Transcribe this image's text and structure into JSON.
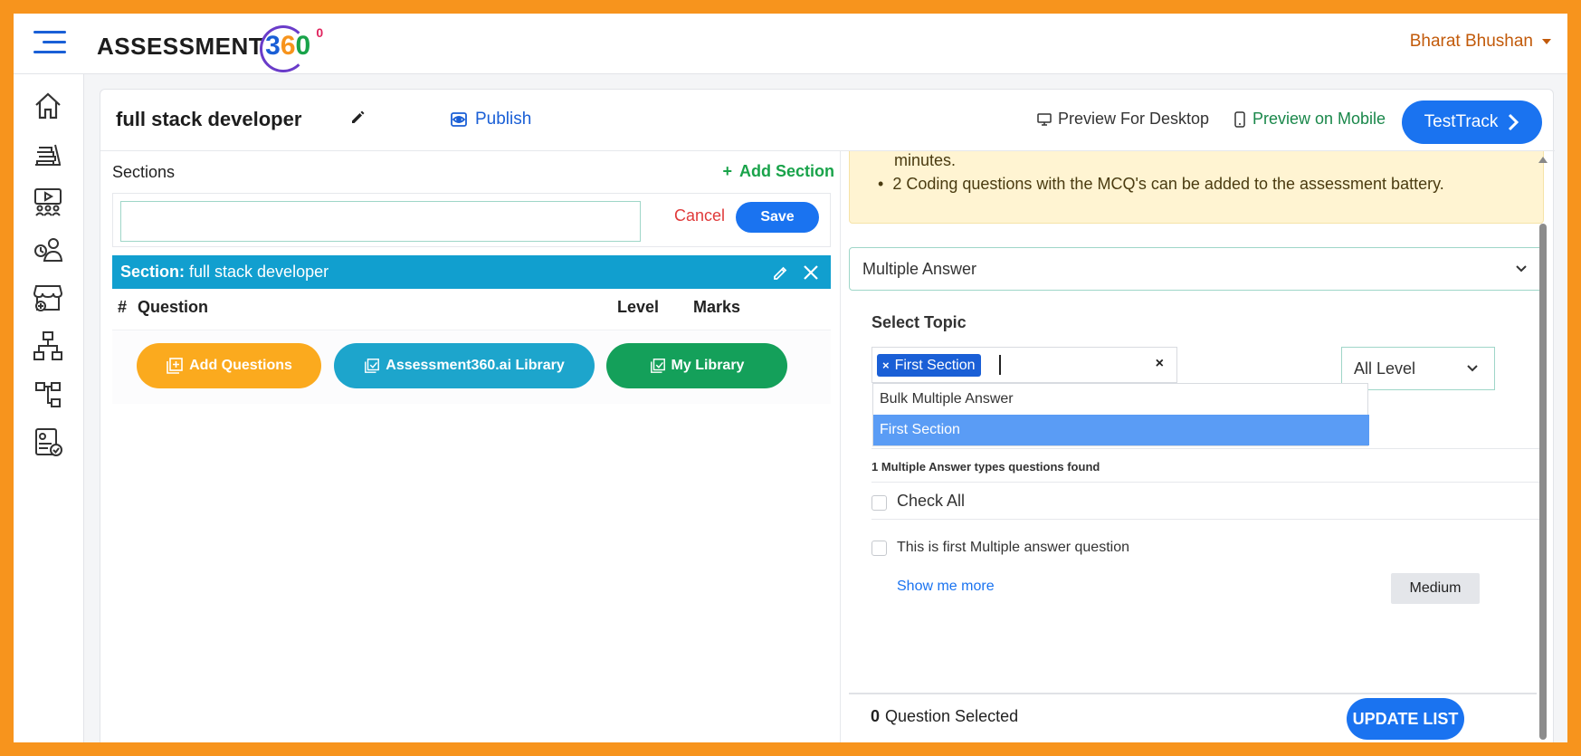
{
  "header": {
    "logo_text": "ASSESSMENT",
    "logo_digits": [
      "3",
      "6",
      "0"
    ],
    "logo_degree": "0",
    "user_name": "Bharat Bhushan"
  },
  "sidebar": {
    "items": [
      {
        "icon": "home-icon"
      },
      {
        "icon": "books-icon"
      },
      {
        "icon": "video-library-icon"
      },
      {
        "icon": "user-settings-icon"
      },
      {
        "icon": "store-add-icon"
      },
      {
        "icon": "hierarchy-icon"
      },
      {
        "icon": "tree-structure-icon"
      },
      {
        "icon": "report-check-icon"
      }
    ]
  },
  "toolbar": {
    "title": "full stack developer",
    "publish_label": "Publish",
    "preview_desktop_label": "Preview For Desktop",
    "preview_mobile_label": "Preview on Mobile",
    "testtrack_label": "TestTrack"
  },
  "left": {
    "sections_label": "Sections",
    "add_section_label": "Add Section",
    "section_input_value": "",
    "cancel_label": "Cancel",
    "save_label": "Save",
    "section_bar_prefix": "Section:",
    "section_bar_name": "full stack developer",
    "columns": {
      "num": "#",
      "question": "Question",
      "level": "Level",
      "marks": "Marks"
    },
    "buttons": {
      "add_questions": "Add Questions",
      "library": "Assessment360.ai Library",
      "my_library": "My Library"
    }
  },
  "right": {
    "notice": {
      "line1": "minutes.",
      "line2": "2 Coding questions with the MCQ's can be added to the assessment battery."
    },
    "question_type": "Multiple Answer",
    "select_topic_label": "Select Topic",
    "topic_chip": "First Section",
    "topic_chip_remove": "×",
    "topic_clear": "×",
    "level_value": "All Level",
    "dropdown_options": [
      "Bulk Multiple Answer",
      "First Section"
    ],
    "found_text": "1 Multiple Answer types questions found",
    "check_all_label": "Check All",
    "questions": [
      {
        "text": "This is first Multiple answer question",
        "show_more": "Show me more",
        "level": "Medium"
      }
    ],
    "selected_count": "0",
    "selected_label": "Question Selected",
    "update_label": "UPDATE LIST"
  },
  "colors": {
    "frame_border": "#f7941d",
    "primary": "#1a73f0",
    "section_bar": "#119fcf",
    "add_questions": "#fbaa1e",
    "library": "#1da5cc",
    "my_library": "#14a05a",
    "notice_bg": "#fff4d2"
  }
}
